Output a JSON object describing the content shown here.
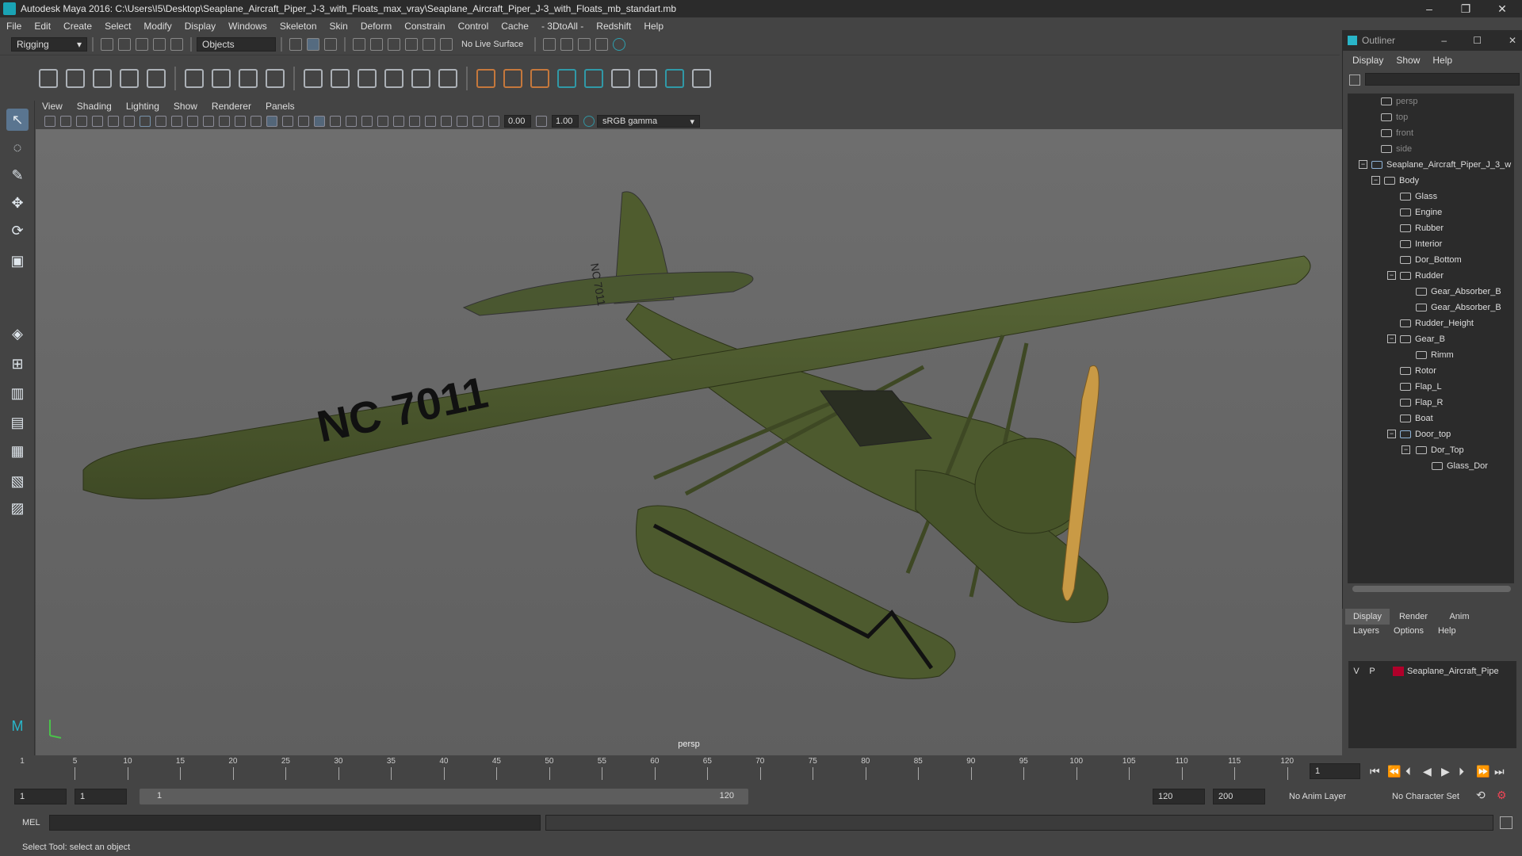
{
  "window": {
    "title": "Autodesk Maya 2016: C:\\Users\\I5\\Desktop\\Seaplane_Aircraft_Piper_J-3_with_Floats_max_vray\\Seaplane_Aircraft_Piper_J-3_with_Floats_mb_standart.mb",
    "minimize": "–",
    "restore": "❐",
    "close": "✕"
  },
  "menubar": [
    "File",
    "Edit",
    "Create",
    "Select",
    "Modify",
    "Display",
    "Windows",
    "Skeleton",
    "Skin",
    "Deform",
    "Constrain",
    "Control",
    "Cache",
    "- 3DtoAll -",
    "Redshift",
    "Help"
  ],
  "shelf": {
    "mode": "Rigging",
    "selection_mode": "Objects",
    "live_surface": "No Live Surface"
  },
  "viewport": {
    "menu": [
      "View",
      "Shading",
      "Lighting",
      "Show",
      "Renderer",
      "Panels"
    ],
    "near_value": "0.00",
    "far_value": "1.00",
    "color_space": "sRGB gamma",
    "camera_label": "persp",
    "model_text": {
      "tail": "NC\n7011",
      "wing": "NC 7011"
    }
  },
  "outliner": {
    "title": "Outliner",
    "menu": [
      "Display",
      "Show",
      "Help"
    ],
    "items": [
      {
        "label": "persp",
        "cam": true
      },
      {
        "label": "top",
        "cam": true
      },
      {
        "label": "front",
        "cam": true
      },
      {
        "label": "side",
        "cam": true
      },
      {
        "label": "Seaplane_Aircraft_Piper_J_3_w"
      },
      {
        "label": "Body"
      },
      {
        "label": "Glass"
      },
      {
        "label": "Engine"
      },
      {
        "label": "Rubber"
      },
      {
        "label": "Interior"
      },
      {
        "label": "Dor_Bottom"
      },
      {
        "label": "Rudder"
      },
      {
        "label": "Gear_Absorber_B"
      },
      {
        "label": "Gear_Absorber_B"
      },
      {
        "label": "Rudder_Height"
      },
      {
        "label": "Gear_B"
      },
      {
        "label": "Rimm"
      },
      {
        "label": "Rotor"
      },
      {
        "label": "Flap_L"
      },
      {
        "label": "Flap_R"
      },
      {
        "label": "Boat"
      },
      {
        "label": "Door_top"
      },
      {
        "label": "Dor_Top"
      },
      {
        "label": "Glass_Dor"
      }
    ]
  },
  "layers": {
    "tabs": [
      "Display",
      "Render",
      "Anim"
    ],
    "menu": [
      "Layers",
      "Options",
      "Help"
    ],
    "row": {
      "v": "V",
      "p": "P",
      "name": "Seaplane_Aircraft_Pipe",
      "color": "#b0002a"
    }
  },
  "timeline": {
    "ticks": [
      "5",
      "10",
      "15",
      "20",
      "25",
      "30",
      "35",
      "40",
      "45",
      "50",
      "55",
      "60",
      "65",
      "70",
      "75",
      "80",
      "85",
      "90",
      "95",
      "100",
      "105",
      "110",
      "115",
      "120"
    ],
    "start_marker": "1",
    "current_frame": "1"
  },
  "range": {
    "start": "1",
    "playback_start": "1",
    "slider_start": "1",
    "slider_end": "120",
    "playback_end": "120",
    "end": "200",
    "anim_layer": "No Anim Layer",
    "character_set": "No Character Set"
  },
  "command": {
    "label": "MEL"
  },
  "help_text": "Select Tool: select an object",
  "colors": {
    "accent": "#5a7590",
    "aircraft": "#4d5a2e",
    "propeller": "#c99a45"
  }
}
